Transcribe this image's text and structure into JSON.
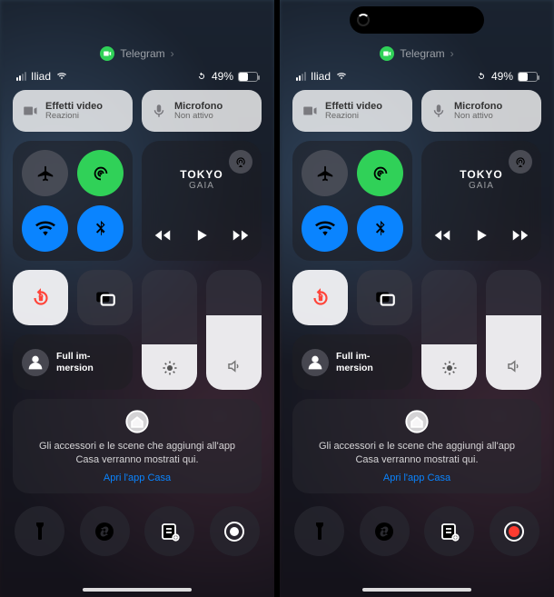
{
  "source_app": {
    "name": "Telegram"
  },
  "status": {
    "carrier": "Iliad",
    "battery_pct": "49%"
  },
  "pills": {
    "video": {
      "title": "Effetti video",
      "subtitle": "Reazioni"
    },
    "mic": {
      "title": "Microfono",
      "subtitle": "Non attivo"
    }
  },
  "media": {
    "title": "TOKYO",
    "artist": "GAIA"
  },
  "focus": {
    "label": "Full im-\nmersion"
  },
  "sliders": {
    "brightness_pct": 38,
    "volume_pct": 62
  },
  "home": {
    "message": "Gli accessori e le scene che aggiungi all'app Casa verranno mostrati qui.",
    "link": "Apri l'app Casa"
  },
  "screens": [
    {
      "has_island": false,
      "recording": false
    },
    {
      "has_island": true,
      "recording": true
    }
  ]
}
